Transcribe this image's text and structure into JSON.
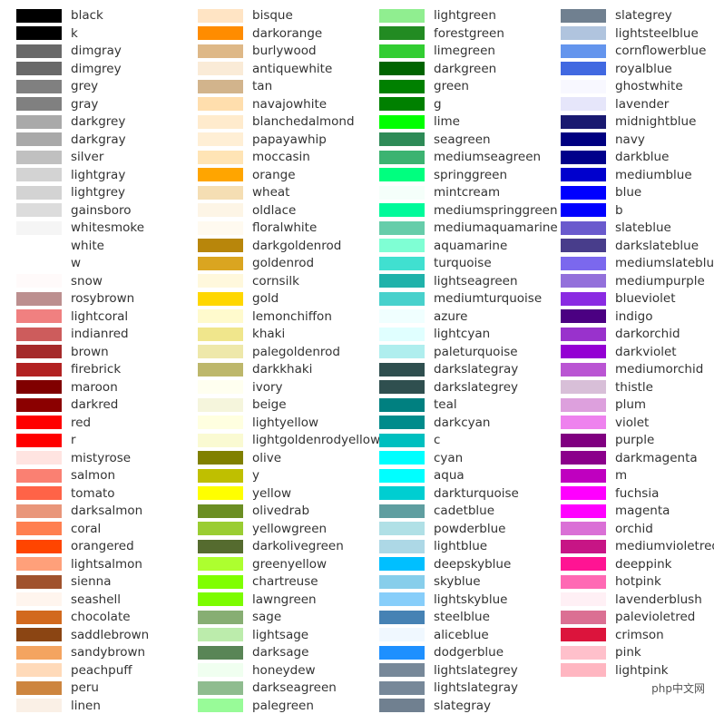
{
  "columns": [
    [
      [
        "black",
        "#000000"
      ],
      [
        "k",
        "#000000"
      ],
      [
        "dimgray",
        "dimgray"
      ],
      [
        "dimgrey",
        "dimgrey"
      ],
      [
        "grey",
        "grey"
      ],
      [
        "gray",
        "gray"
      ],
      [
        "darkgrey",
        "darkgrey"
      ],
      [
        "darkgray",
        "darkgray"
      ],
      [
        "silver",
        "silver"
      ],
      [
        "lightgray",
        "lightgray"
      ],
      [
        "lightgrey",
        "lightgrey"
      ],
      [
        "gainsboro",
        "gainsboro"
      ],
      [
        "whitesmoke",
        "whitesmoke"
      ],
      [
        "white",
        "#ffffff"
      ],
      [
        "w",
        "#ffffff"
      ],
      [
        "snow",
        "snow"
      ],
      [
        "rosybrown",
        "rosybrown"
      ],
      [
        "lightcoral",
        "lightcoral"
      ],
      [
        "indianred",
        "indianred"
      ],
      [
        "brown",
        "brown"
      ],
      [
        "firebrick",
        "firebrick"
      ],
      [
        "maroon",
        "maroon"
      ],
      [
        "darkred",
        "darkred"
      ],
      [
        "red",
        "#ff0000"
      ],
      [
        "r",
        "#ff0000"
      ],
      [
        "mistyrose",
        "mistyrose"
      ],
      [
        "salmon",
        "salmon"
      ],
      [
        "tomato",
        "tomato"
      ],
      [
        "darksalmon",
        "darksalmon"
      ],
      [
        "coral",
        "coral"
      ],
      [
        "orangered",
        "orangered"
      ],
      [
        "lightsalmon",
        "lightsalmon"
      ],
      [
        "sienna",
        "sienna"
      ],
      [
        "seashell",
        "seashell"
      ],
      [
        "chocolate",
        "chocolate"
      ],
      [
        "saddlebrown",
        "saddlebrown"
      ],
      [
        "sandybrown",
        "sandybrown"
      ],
      [
        "peachpuff",
        "peachpuff"
      ],
      [
        "peru",
        "peru"
      ],
      [
        "linen",
        "linen"
      ]
    ],
    [
      [
        "bisque",
        "bisque"
      ],
      [
        "darkorange",
        "darkorange"
      ],
      [
        "burlywood",
        "burlywood"
      ],
      [
        "antiquewhite",
        "antiquewhite"
      ],
      [
        "tan",
        "tan"
      ],
      [
        "navajowhite",
        "navajowhite"
      ],
      [
        "blanchedalmond",
        "blanchedalmond"
      ],
      [
        "papayawhip",
        "papayawhip"
      ],
      [
        "moccasin",
        "moccasin"
      ],
      [
        "orange",
        "orange"
      ],
      [
        "wheat",
        "wheat"
      ],
      [
        "oldlace",
        "oldlace"
      ],
      [
        "floralwhite",
        "floralwhite"
      ],
      [
        "darkgoldenrod",
        "darkgoldenrod"
      ],
      [
        "goldenrod",
        "goldenrod"
      ],
      [
        "cornsilk",
        "cornsilk"
      ],
      [
        "gold",
        "gold"
      ],
      [
        "lemonchiffon",
        "lemonchiffon"
      ],
      [
        "khaki",
        "khaki"
      ],
      [
        "palegoldenrod",
        "palegoldenrod"
      ],
      [
        "darkkhaki",
        "darkkhaki"
      ],
      [
        "ivory",
        "ivory"
      ],
      [
        "beige",
        "beige"
      ],
      [
        "lightyellow",
        "lightyellow"
      ],
      [
        "lightgoldenrodyellow",
        "lightgoldenrodyellow"
      ],
      [
        "olive",
        "olive"
      ],
      [
        "y",
        "#bfbf00"
      ],
      [
        "yellow",
        "yellow"
      ],
      [
        "olivedrab",
        "olivedrab"
      ],
      [
        "yellowgreen",
        "yellowgreen"
      ],
      [
        "darkolivegreen",
        "darkolivegreen"
      ],
      [
        "greenyellow",
        "greenyellow"
      ],
      [
        "chartreuse",
        "chartreuse"
      ],
      [
        "lawngreen",
        "lawngreen"
      ],
      [
        "sage",
        "#87ae73"
      ],
      [
        "lightsage",
        "#bcecac"
      ],
      [
        "darksage",
        "#598556"
      ],
      [
        "honeydew",
        "honeydew"
      ],
      [
        "darkseagreen",
        "darkseagreen"
      ],
      [
        "palegreen",
        "palegreen"
      ]
    ],
    [
      [
        "lightgreen",
        "lightgreen"
      ],
      [
        "forestgreen",
        "forestgreen"
      ],
      [
        "limegreen",
        "limegreen"
      ],
      [
        "darkgreen",
        "darkgreen"
      ],
      [
        "green",
        "green"
      ],
      [
        "g",
        "#008000"
      ],
      [
        "lime",
        "lime"
      ],
      [
        "seagreen",
        "seagreen"
      ],
      [
        "mediumseagreen",
        "mediumseagreen"
      ],
      [
        "springgreen",
        "springgreen"
      ],
      [
        "mintcream",
        "mintcream"
      ],
      [
        "mediumspringgreen",
        "mediumspringgreen"
      ],
      [
        "mediumaquamarine",
        "mediumaquamarine"
      ],
      [
        "aquamarine",
        "aquamarine"
      ],
      [
        "turquoise",
        "turquoise"
      ],
      [
        "lightseagreen",
        "lightseagreen"
      ],
      [
        "mediumturquoise",
        "mediumturquoise"
      ],
      [
        "azure",
        "azure"
      ],
      [
        "lightcyan",
        "lightcyan"
      ],
      [
        "paleturquoise",
        "paleturquoise"
      ],
      [
        "darkslategray",
        "darkslategray"
      ],
      [
        "darkslategrey",
        "darkslategrey"
      ],
      [
        "teal",
        "teal"
      ],
      [
        "darkcyan",
        "darkcyan"
      ],
      [
        "c",
        "#00bfbf"
      ],
      [
        "cyan",
        "cyan"
      ],
      [
        "aqua",
        "aqua"
      ],
      [
        "darkturquoise",
        "darkturquoise"
      ],
      [
        "cadetblue",
        "cadetblue"
      ],
      [
        "powderblue",
        "powderblue"
      ],
      [
        "lightblue",
        "lightblue"
      ],
      [
        "deepskyblue",
        "deepskyblue"
      ],
      [
        "skyblue",
        "skyblue"
      ],
      [
        "lightskyblue",
        "lightskyblue"
      ],
      [
        "steelblue",
        "steelblue"
      ],
      [
        "aliceblue",
        "aliceblue"
      ],
      [
        "dodgerblue",
        "dodgerblue"
      ],
      [
        "lightslategrey",
        "lightslategrey"
      ],
      [
        "lightslategray",
        "lightslategray"
      ],
      [
        "slategray",
        "slategray"
      ]
    ],
    [
      [
        "slategrey",
        "slategrey"
      ],
      [
        "lightsteelblue",
        "lightsteelblue"
      ],
      [
        "cornflowerblue",
        "cornflowerblue"
      ],
      [
        "royalblue",
        "royalblue"
      ],
      [
        "ghostwhite",
        "ghostwhite"
      ],
      [
        "lavender",
        "lavender"
      ],
      [
        "midnightblue",
        "midnightblue"
      ],
      [
        "navy",
        "navy"
      ],
      [
        "darkblue",
        "darkblue"
      ],
      [
        "mediumblue",
        "mediumblue"
      ],
      [
        "blue",
        "blue"
      ],
      [
        "b",
        "#0000ff"
      ],
      [
        "slateblue",
        "slateblue"
      ],
      [
        "darkslateblue",
        "darkslateblue"
      ],
      [
        "mediumslateblue",
        "mediumslateblue"
      ],
      [
        "mediumpurple",
        "mediumpurple"
      ],
      [
        "blueviolet",
        "blueviolet"
      ],
      [
        "indigo",
        "indigo"
      ],
      [
        "darkorchid",
        "darkorchid"
      ],
      [
        "darkviolet",
        "darkviolet"
      ],
      [
        "mediumorchid",
        "mediumorchid"
      ],
      [
        "thistle",
        "thistle"
      ],
      [
        "plum",
        "plum"
      ],
      [
        "violet",
        "violet"
      ],
      [
        "purple",
        "purple"
      ],
      [
        "darkmagenta",
        "darkmagenta"
      ],
      [
        "m",
        "#bf00bf"
      ],
      [
        "fuchsia",
        "fuchsia"
      ],
      [
        "magenta",
        "magenta"
      ],
      [
        "orchid",
        "orchid"
      ],
      [
        "mediumvioletred",
        "mediumvioletred"
      ],
      [
        "deeppink",
        "deeppink"
      ],
      [
        "hotpink",
        "hotpink"
      ],
      [
        "lavenderblush",
        "lavenderblush"
      ],
      [
        "palevioletred",
        "palevioletred"
      ],
      [
        "crimson",
        "crimson"
      ],
      [
        "pink",
        "pink"
      ],
      [
        "lightpink",
        "lightpink"
      ]
    ]
  ],
  "watermark": "php中文网"
}
